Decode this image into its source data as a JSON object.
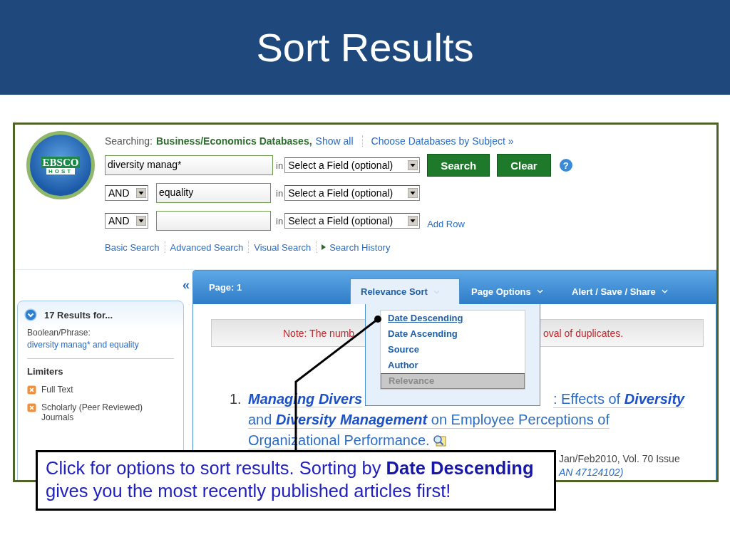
{
  "slide": {
    "title": "Sort Results"
  },
  "logo": {
    "line1": "EBSCO",
    "line2": "HOST"
  },
  "searching": {
    "label": "Searching:",
    "databases": "Business/Economics Databases,",
    "show_all": "Show all",
    "choose": "Choose Databases by Subject »"
  },
  "search_rows": [
    {
      "value": "diversity manag*",
      "in": "in",
      "field": "Select a Field (optional)"
    },
    {
      "operator": "AND",
      "value": "equality",
      "in": "in",
      "field": "Select a Field (optional)"
    },
    {
      "operator": "AND",
      "in": "in",
      "field": "Select a Field (optional)"
    }
  ],
  "buttons": [
    {
      "label": "Search"
    },
    {
      "label": "Clear"
    }
  ],
  "help": "?",
  "add_row": "Add Row",
  "search_links": [
    {
      "label": "Basic Search",
      "kind": "plain"
    },
    {
      "label": "Advanced Search",
      "kind": "plain"
    },
    {
      "label": "Visual Search",
      "kind": "plain"
    },
    {
      "label": "Search History",
      "kind": "arrow"
    }
  ],
  "sidebar": {
    "collapse": "«",
    "results_heading": "17 Results for...",
    "query_label": "Boolean/Phrase:",
    "query": "diversity manag* and equality",
    "limiters_heading": "Limiters",
    "limiters": [
      {
        "label": "Full Text"
      },
      {
        "label": "Scholarly (Peer Reviewed) Journals"
      }
    ]
  },
  "toolbar": {
    "page": "Page: 1",
    "menus": [
      {
        "label": "Relevance Sort",
        "open": true
      },
      {
        "label": "Page Options",
        "open": false
      },
      {
        "label": "Alert / Save / Share",
        "open": false
      }
    ]
  },
  "sort_menu": {
    "items": [
      {
        "label": "Date Descending",
        "selected": false,
        "highlighted": true
      },
      {
        "label": "Date Ascending",
        "selected": false,
        "highlighted": false
      },
      {
        "label": "Source",
        "selected": false,
        "highlighted": false
      },
      {
        "label": "Author",
        "selected": false,
        "highlighted": false
      },
      {
        "label": "Relevance",
        "selected": true,
        "highlighted": false
      }
    ]
  },
  "note": {
    "left": "Note: The numb",
    "right": "oval of duplicates."
  },
  "result": {
    "number": "1.",
    "title_start": "Managing Divers",
    "title_end": ": Effects of **Diversity**",
    "title_line2": "and **Diversity Management** on Employee Perceptions of",
    "title_line3": "Organizational Performance.",
    "citation": "Jan/Feb2010, Vol. 70 Issue",
    "accession": "AN 47124102)"
  },
  "callout": {
    "text": "Click for options to sort results. Sorting by **Date Descending** gives you the most recently published articles first!"
  }
}
